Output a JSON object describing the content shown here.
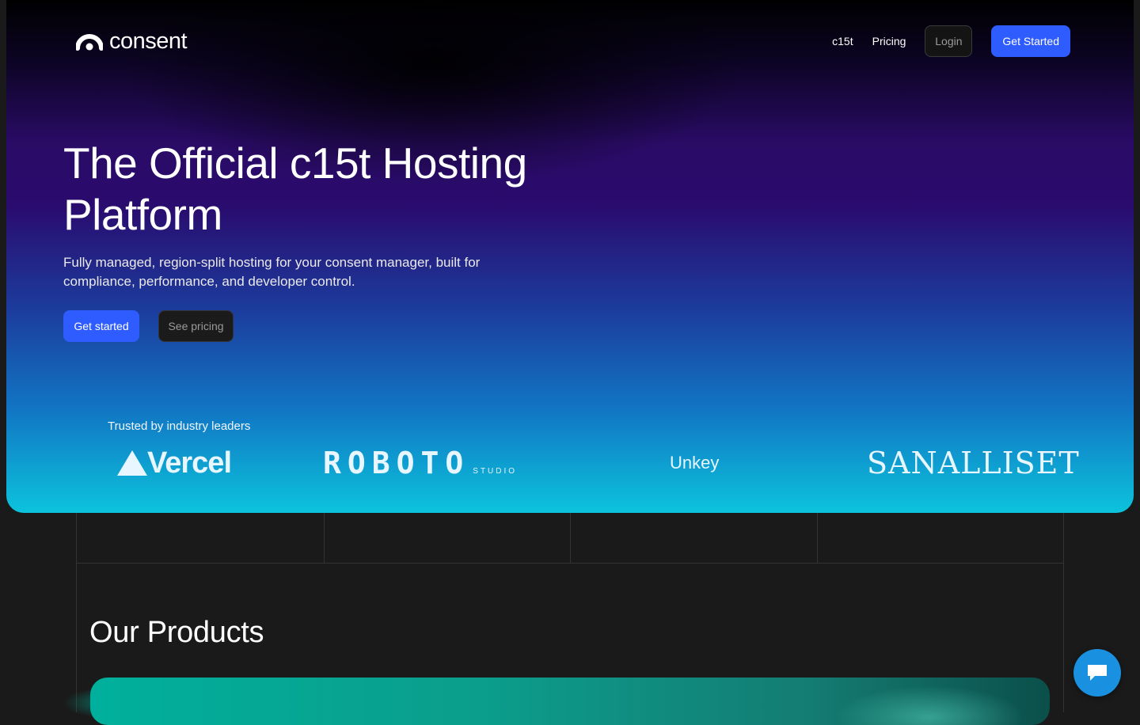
{
  "brand": {
    "name": "consent"
  },
  "nav": {
    "links": [
      "c15t",
      "Pricing"
    ],
    "login_label": "Login",
    "get_started_label": "Get Started"
  },
  "hero": {
    "title": "The Official c15t Hosting Platform",
    "subtitle": "Fully managed, region-split hosting for your consent manager, built for compliance, performance, and developer control.",
    "cta_primary": "Get started",
    "cta_secondary": "See pricing"
  },
  "trusted": {
    "label": "Trusted by industry leaders",
    "logos": {
      "vercel": "Vercel",
      "roboto": "ROBOTO",
      "roboto_sub": "STUDIO",
      "unkey": "Unkey",
      "sanalliset": "SANALLISET"
    }
  },
  "products": {
    "title": "Our Products"
  },
  "colors": {
    "accent": "#2f5cff",
    "chat": "#1a90e0",
    "background": "#1a1a1a"
  },
  "icons": {
    "logo": "consent-logo-icon",
    "chat": "chat-bubble-icon"
  }
}
